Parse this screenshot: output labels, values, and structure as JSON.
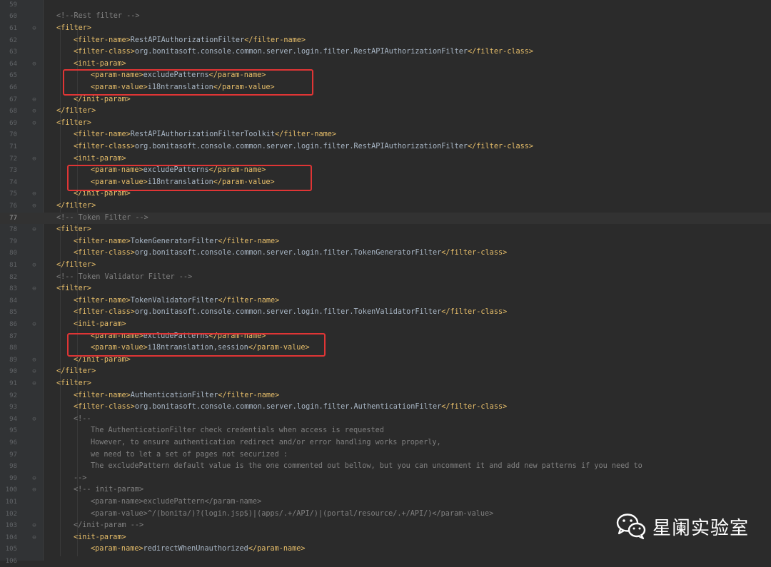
{
  "editor": {
    "current_line": "77",
    "lines": [
      {
        "num": "59",
        "indent": 0,
        "parts": []
      },
      {
        "num": "60",
        "indent": 0,
        "parts": [
          {
            "c": "cm",
            "t": "<!--Rest filter -->"
          }
        ]
      },
      {
        "num": "61",
        "indent": 0,
        "fold": "⊖",
        "parts": [
          {
            "c": "t",
            "t": "<filter>"
          }
        ]
      },
      {
        "num": "62",
        "indent": 1,
        "parts": [
          {
            "c": "t",
            "t": "<filter-name>"
          },
          {
            "c": "txt",
            "t": "RestAPIAuthorizationFilter"
          },
          {
            "c": "t",
            "t": "</filter-name>"
          }
        ]
      },
      {
        "num": "63",
        "indent": 1,
        "parts": [
          {
            "c": "t",
            "t": "<filter-class>"
          },
          {
            "c": "txt",
            "t": "org.bonitasoft.console.common.server.login.filter.RestAPIAuthorizationFilter"
          },
          {
            "c": "t",
            "t": "</filter-class>"
          }
        ]
      },
      {
        "num": "64",
        "indent": 1,
        "fold": "⊖",
        "parts": [
          {
            "c": "t",
            "t": "<init-param>"
          }
        ]
      },
      {
        "num": "65",
        "indent": 2,
        "parts": [
          {
            "c": "t",
            "t": "<param-name>"
          },
          {
            "c": "txt",
            "t": "excludePatterns"
          },
          {
            "c": "t",
            "t": "</param-name>"
          }
        ]
      },
      {
        "num": "66",
        "indent": 2,
        "parts": [
          {
            "c": "t",
            "t": "<param-value>"
          },
          {
            "c": "txt",
            "t": "i18ntranslation"
          },
          {
            "c": "t",
            "t": "</param-value>"
          }
        ]
      },
      {
        "num": "67",
        "indent": 1,
        "fold": "⊖",
        "parts": [
          {
            "c": "t",
            "t": "</init-param>"
          }
        ]
      },
      {
        "num": "68",
        "indent": 0,
        "fold": "⊖",
        "parts": [
          {
            "c": "t",
            "t": "</filter>"
          }
        ]
      },
      {
        "num": "69",
        "indent": 0,
        "fold": "⊖",
        "parts": [
          {
            "c": "t",
            "t": "<filter>"
          }
        ]
      },
      {
        "num": "70",
        "indent": 1,
        "parts": [
          {
            "c": "t",
            "t": "<filter-name>"
          },
          {
            "c": "txt",
            "t": "RestAPIAuthorizationFilterToolkit"
          },
          {
            "c": "t",
            "t": "</filter-name>"
          }
        ]
      },
      {
        "num": "71",
        "indent": 1,
        "parts": [
          {
            "c": "t",
            "t": "<filter-class>"
          },
          {
            "c": "txt",
            "t": "org.bonitasoft.console.common.server.login.filter.RestAPIAuthorizationFilter"
          },
          {
            "c": "t",
            "t": "</filter-class>"
          }
        ]
      },
      {
        "num": "72",
        "indent": 1,
        "fold": "⊖",
        "parts": [
          {
            "c": "t",
            "t": "<init-param>"
          }
        ]
      },
      {
        "num": "73",
        "indent": 2,
        "parts": [
          {
            "c": "t",
            "t": "<param-name>"
          },
          {
            "c": "txt",
            "t": "excludePatterns"
          },
          {
            "c": "t",
            "t": "</param-name>"
          }
        ]
      },
      {
        "num": "74",
        "indent": 2,
        "parts": [
          {
            "c": "t",
            "t": "<param-value>"
          },
          {
            "c": "txt",
            "t": "i18ntranslation"
          },
          {
            "c": "t",
            "t": "</param-value>"
          }
        ]
      },
      {
        "num": "75",
        "indent": 1,
        "fold": "⊖",
        "parts": [
          {
            "c": "t",
            "t": "</init-param>"
          }
        ]
      },
      {
        "num": "76",
        "indent": 0,
        "fold": "⊖",
        "parts": [
          {
            "c": "t",
            "t": "</filter>"
          }
        ]
      },
      {
        "num": "77",
        "indent": 0,
        "parts": [
          {
            "c": "cm",
            "t": "<!-- Token Filter -->"
          }
        ]
      },
      {
        "num": "78",
        "indent": 0,
        "fold": "⊖",
        "parts": [
          {
            "c": "t",
            "t": "<filter>"
          }
        ]
      },
      {
        "num": "79",
        "indent": 1,
        "parts": [
          {
            "c": "t",
            "t": "<filter-name>"
          },
          {
            "c": "txt",
            "t": "TokenGeneratorFilter"
          },
          {
            "c": "t",
            "t": "</filter-name>"
          }
        ]
      },
      {
        "num": "80",
        "indent": 1,
        "parts": [
          {
            "c": "t",
            "t": "<filter-class>"
          },
          {
            "c": "txt",
            "t": "org.bonitasoft.console.common.server.login.filter.TokenGeneratorFilter"
          },
          {
            "c": "t",
            "t": "</filter-class>"
          }
        ]
      },
      {
        "num": "81",
        "indent": 0,
        "fold": "⊖",
        "parts": [
          {
            "c": "t",
            "t": "</filter>"
          }
        ]
      },
      {
        "num": "82",
        "indent": 0,
        "parts": [
          {
            "c": "cm",
            "t": "<!-- Token Validator Filter -->"
          }
        ]
      },
      {
        "num": "83",
        "indent": 0,
        "fold": "⊖",
        "parts": [
          {
            "c": "t",
            "t": "<filter>"
          }
        ]
      },
      {
        "num": "84",
        "indent": 1,
        "parts": [
          {
            "c": "t",
            "t": "<filter-name>"
          },
          {
            "c": "txt",
            "t": "TokenValidatorFilter"
          },
          {
            "c": "t",
            "t": "</filter-name>"
          }
        ]
      },
      {
        "num": "85",
        "indent": 1,
        "parts": [
          {
            "c": "t",
            "t": "<filter-class>"
          },
          {
            "c": "txt",
            "t": "org.bonitasoft.console.common.server.login.filter.TokenValidatorFilter"
          },
          {
            "c": "t",
            "t": "</filter-class>"
          }
        ]
      },
      {
        "num": "86",
        "indent": 1,
        "fold": "⊖",
        "parts": [
          {
            "c": "t",
            "t": "<init-param>"
          }
        ]
      },
      {
        "num": "87",
        "indent": 2,
        "parts": [
          {
            "c": "t",
            "t": "<param-name>"
          },
          {
            "c": "txt",
            "t": "excludePatterns"
          },
          {
            "c": "t",
            "t": "</param-name>"
          }
        ]
      },
      {
        "num": "88",
        "indent": 2,
        "parts": [
          {
            "c": "t",
            "t": "<param-value>"
          },
          {
            "c": "txt",
            "t": "i18ntranslation,session"
          },
          {
            "c": "t",
            "t": "</param-value>"
          }
        ]
      },
      {
        "num": "89",
        "indent": 1,
        "fold": "⊖",
        "parts": [
          {
            "c": "t",
            "t": "</init-param>"
          }
        ]
      },
      {
        "num": "90",
        "indent": 0,
        "fold": "⊖",
        "parts": [
          {
            "c": "t",
            "t": "</filter>"
          }
        ]
      },
      {
        "num": "91",
        "indent": 0,
        "fold": "⊖",
        "parts": [
          {
            "c": "t",
            "t": "<filter>"
          }
        ]
      },
      {
        "num": "92",
        "indent": 1,
        "parts": [
          {
            "c": "t",
            "t": "<filter-name>"
          },
          {
            "c": "txt",
            "t": "AuthenticationFilter"
          },
          {
            "c": "t",
            "t": "</filter-name>"
          }
        ]
      },
      {
        "num": "93",
        "indent": 1,
        "parts": [
          {
            "c": "t",
            "t": "<filter-class>"
          },
          {
            "c": "txt",
            "t": "org.bonitasoft.console.common.server.login.filter.AuthenticationFilter"
          },
          {
            "c": "t",
            "t": "</filter-class>"
          }
        ]
      },
      {
        "num": "94",
        "indent": 1,
        "fold": "⊖",
        "parts": [
          {
            "c": "cm",
            "t": "<!--"
          }
        ]
      },
      {
        "num": "95",
        "indent": 2,
        "parts": [
          {
            "c": "cm",
            "t": "The AuthenticationFilter check credentials when access is requested"
          }
        ]
      },
      {
        "num": "96",
        "indent": 2,
        "parts": [
          {
            "c": "cm",
            "t": "However, to ensure authentication redirect and/or error handling works properly,"
          }
        ]
      },
      {
        "num": "97",
        "indent": 2,
        "parts": [
          {
            "c": "cm",
            "t": "we need to let a set of pages not securized :"
          }
        ]
      },
      {
        "num": "98",
        "indent": 2,
        "parts": [
          {
            "c": "cm",
            "t": "The excludePattern default value is the one commented out bellow, but you can uncomment it and add new patterns if you need to"
          }
        ]
      },
      {
        "num": "99",
        "indent": 1,
        "fold": "⊖",
        "parts": [
          {
            "c": "cm",
            "t": "-->"
          }
        ]
      },
      {
        "num": "100",
        "indent": 1,
        "fold": "⊖",
        "parts": [
          {
            "c": "cm",
            "t": "<!-- init-param>"
          }
        ]
      },
      {
        "num": "101",
        "indent": 2,
        "parts": [
          {
            "c": "cm",
            "t": "<param-name>excludePattern</param-name>"
          }
        ]
      },
      {
        "num": "102",
        "indent": 2,
        "parts": [
          {
            "c": "cm",
            "t": "<param-value>^/(bonita/)?(login.jsp$)|(apps/.+/API/)|(portal/resource/.+/API/)</param-value>"
          }
        ]
      },
      {
        "num": "103",
        "indent": 1,
        "fold": "⊖",
        "parts": [
          {
            "c": "cm",
            "t": "</init-param -->"
          }
        ]
      },
      {
        "num": "104",
        "indent": 1,
        "fold": "⊖",
        "parts": [
          {
            "c": "t",
            "t": "<init-param>"
          }
        ]
      },
      {
        "num": "105",
        "indent": 2,
        "parts": [
          {
            "c": "t",
            "t": "<param-name>"
          },
          {
            "c": "txt",
            "t": "redirectWhenUnauthorized"
          },
          {
            "c": "t",
            "t": "</param-name>"
          }
        ]
      },
      {
        "num": "106",
        "indent": 2,
        "parts": []
      }
    ]
  },
  "highlights": [
    {
      "id": "highlight-box-1"
    },
    {
      "id": "highlight-box-2"
    },
    {
      "id": "highlight-box-3"
    }
  ],
  "watermark": {
    "icon": "wechat-icon",
    "text": "星阑实验室"
  },
  "colors": {
    "background": "#2b2b2b",
    "tag": "#e8bf6a",
    "text": "#a9b7c6",
    "comment": "#808080",
    "highlight_box": "#e03535"
  }
}
